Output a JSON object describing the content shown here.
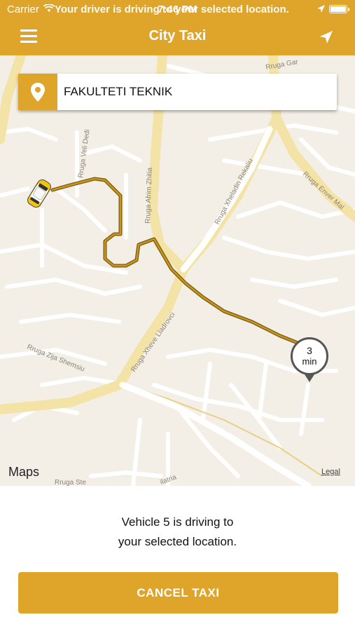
{
  "status_bar": {
    "carrier": "Carrier",
    "time": "7:46 PM",
    "banner": "Your driver is driving to your selected location."
  },
  "nav": {
    "title": "City Taxi"
  },
  "map": {
    "destination": "FAKULTETI TEKNIK",
    "eta_value": "3",
    "eta_unit": "min",
    "maps_label": "Maps",
    "legal_label": "Legal",
    "street_labels": {
      "s1": "Rruga Gar",
      "s2": "Rruga Veli Dedi",
      "s3": "Rruga Afrim Zhitia",
      "s4": "Rruga Xheladin Rekaliu",
      "s5": "Rruga Enver Mal",
      "s6": "Rruga Zija Shemsiu",
      "s7": "Rruga Xheve Lladrovci",
      "s8": "Rruga Ste",
      "s9": "ilatria"
    }
  },
  "bottom": {
    "message_line1": "Vehicle 5 is driving to",
    "message_line2": "your selected location.",
    "cancel_label": "CANCEL TAXI"
  },
  "colors": {
    "accent": "#dfa52a",
    "route": "#a07a1e"
  }
}
